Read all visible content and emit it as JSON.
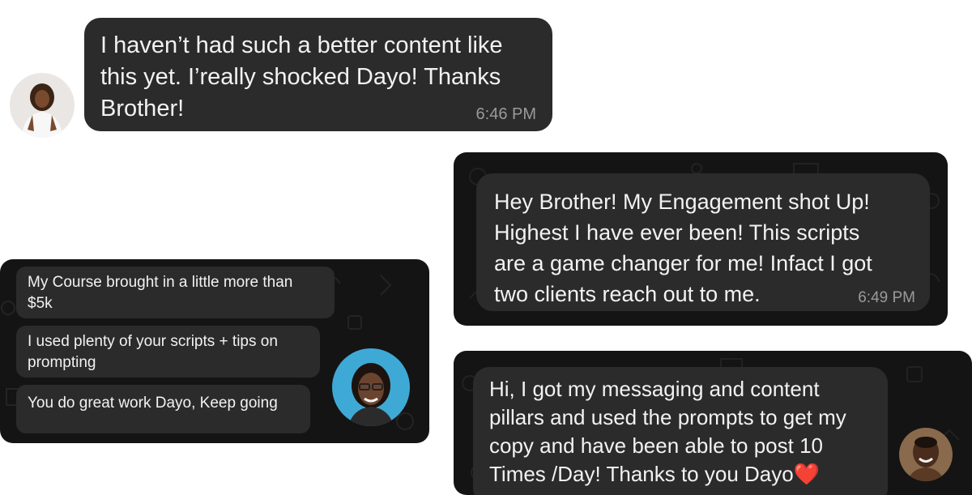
{
  "testimonial_1": {
    "message": "I haven’t had such a better content like this yet. I’really shocked Dayo! Thanks Brother!",
    "line1": "I haven’t had such a better content like",
    "line2": "this yet. I’really shocked Dayo! Thanks",
    "line3": "Brother!",
    "time": "6:46 PM"
  },
  "testimonial_2": {
    "line1": "Hey Brother! My Engagement shot Up!",
    "line2": "Highest I have ever been! This scripts",
    "line3": "are a game changer for me! Infact I got",
    "line4": "two clients reach out to me.",
    "time": "6:49 PM"
  },
  "testimonial_3": {
    "messages": [
      {
        "line1": "My Course brought in a little more than",
        "line2": "$5k"
      },
      {
        "line1": "I used plenty of your scripts + tips on",
        "line2": "prompting"
      },
      {
        "line1": "You do great work Dayo, Keep going"
      }
    ]
  },
  "testimonial_4": {
    "line1": "Hi, I got my messaging and content",
    "line2": "pillars and used the prompts to get my",
    "line3": "copy and have been able to post 10",
    "line4": "Times /Day! Thanks to you Dayo",
    "emoji": "❤️"
  },
  "colors": {
    "bubble": "#2b2b2b",
    "panel": "#141414",
    "text": "#f2f2f2",
    "timestamp": "#9a9a9a",
    "heart": "#e3262e"
  }
}
